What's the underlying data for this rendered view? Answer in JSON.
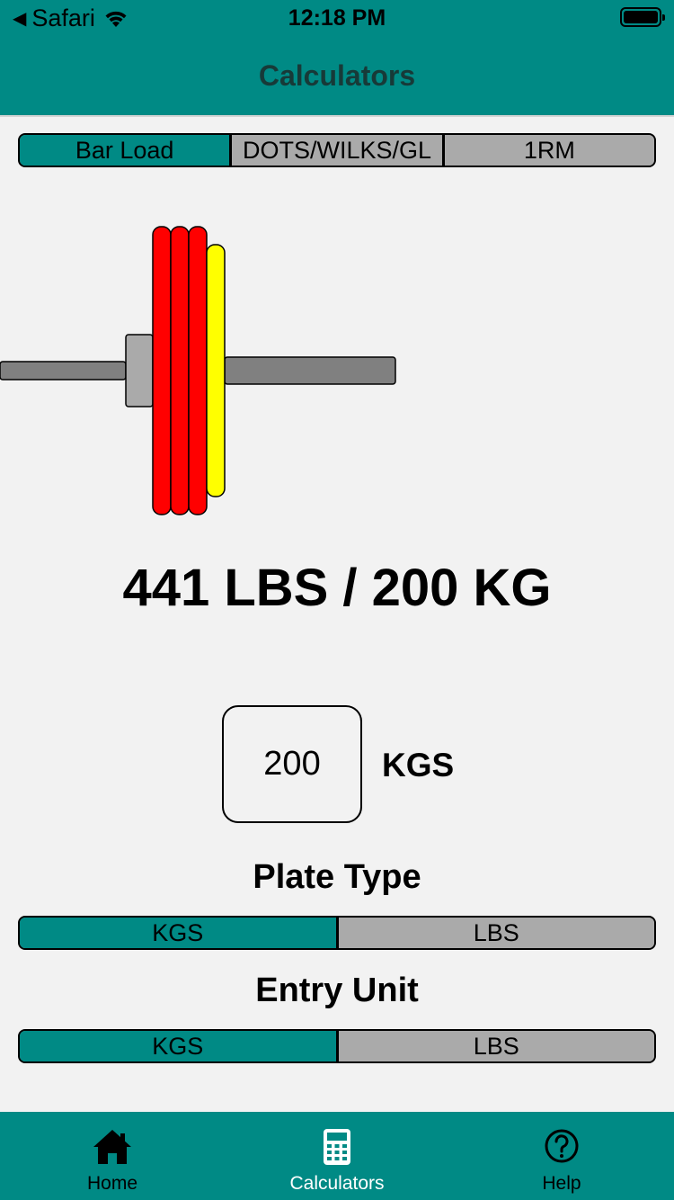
{
  "status_bar": {
    "back_app": "Safari",
    "time": "12:18 PM"
  },
  "header": {
    "title": "Calculators"
  },
  "calculator_tabs": [
    {
      "label": "Bar Load",
      "active": true
    },
    {
      "label": "DOTS/WILKS/GL",
      "active": false
    },
    {
      "label": "1RM",
      "active": false
    }
  ],
  "bar_load": {
    "plates": [
      {
        "color": "#ff0000",
        "size": "large"
      },
      {
        "color": "#ff0000",
        "size": "large"
      },
      {
        "color": "#ff0000",
        "size": "large"
      },
      {
        "color": "#ffff00",
        "size": "medium"
      }
    ],
    "total_text": "441 LBS / 200 KG",
    "weight_value": "200",
    "weight_unit": "KGS"
  },
  "plate_type": {
    "label": "Plate Type",
    "options": [
      {
        "label": "KGS",
        "active": true
      },
      {
        "label": "LBS",
        "active": false
      }
    ]
  },
  "entry_unit": {
    "label": "Entry Unit",
    "options": [
      {
        "label": "KGS",
        "active": true
      },
      {
        "label": "LBS",
        "active": false
      }
    ]
  },
  "tab_bar": [
    {
      "label": "Home",
      "icon": "home-icon",
      "active": false
    },
    {
      "label": "Calculators",
      "icon": "calculator-icon",
      "active": true
    },
    {
      "label": "Help",
      "icon": "help-icon",
      "active": false
    }
  ],
  "colors": {
    "accent": "#008a85",
    "inactive": "#aaaaaa",
    "background": "#f2f2f2"
  }
}
